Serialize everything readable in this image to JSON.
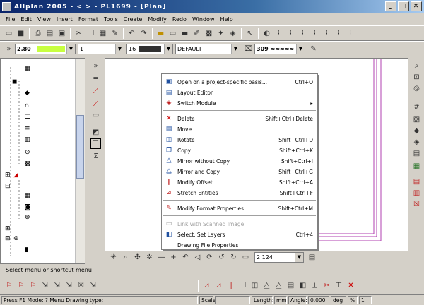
{
  "title": "Allplan 2005 - < > - PL1699 - [Plan]",
  "window": {
    "min": "_",
    "max": "□",
    "close": "✕"
  },
  "menu": [
    "File",
    "Edit",
    "View",
    "Insert",
    "Format",
    "Tools",
    "Create",
    "Modify",
    "Redo",
    "Window",
    "Help"
  ],
  "format_bar": {
    "pen_value": "2.80",
    "line_value": "1",
    "color_value": "16",
    "layer_value": "DEFAULT",
    "style_value": "309 ≈≈≈≈≈"
  },
  "context_menu": {
    "items": [
      {
        "label": "Open on a project-specific basis...",
        "shortcut": "Ctrl+O",
        "icon": "open-icon",
        "disabled": false
      },
      {
        "label": "Layout Editor",
        "shortcut": "",
        "icon": "layout-icon",
        "disabled": false
      },
      {
        "label": "Switch Module",
        "shortcut": "",
        "icon": "module-icon",
        "disabled": false,
        "submenu": true
      },
      {
        "label": "Delete",
        "shortcut": "Shift+Ctrl+Delete",
        "icon": "delete-icon",
        "disabled": false
      },
      {
        "label": "Move",
        "shortcut": "",
        "icon": "move-icon",
        "disabled": false
      },
      {
        "label": "Rotate",
        "shortcut": "Shift+Ctrl+D",
        "icon": "rotate-icon",
        "disabled": false
      },
      {
        "label": "Copy",
        "shortcut": "Shift+Ctrl+K",
        "icon": "copy-icon",
        "disabled": false
      },
      {
        "label": "Mirror without Copy",
        "shortcut": "Shift+Ctrl+I",
        "icon": "mirror-icon",
        "disabled": false
      },
      {
        "label": "Mirror and Copy",
        "shortcut": "Shift+Ctrl+G",
        "icon": "mirror-copy-icon",
        "disabled": false
      },
      {
        "label": "Modify Offset",
        "shortcut": "Shift+Ctrl+A",
        "icon": "offset-icon",
        "disabled": false
      },
      {
        "label": "Stretch Entities",
        "shortcut": "Shift+Ctrl+F",
        "icon": "stretch-icon",
        "disabled": false
      },
      {
        "label": "Modify Format Properties",
        "shortcut": "Shift+Ctrl+M",
        "icon": "format-icon",
        "disabled": false
      },
      {
        "label": "Link with Scanned Image",
        "shortcut": "",
        "icon": "scan-icon",
        "disabled": true
      },
      {
        "label": "Select, Set Layers",
        "shortcut": "Ctrl+4",
        "icon": "layers-icon",
        "disabled": false
      },
      {
        "label": "Drawing File Properties",
        "shortcut": "",
        "icon": "",
        "disabled": false
      }
    ]
  },
  "bottom_toolbar": {
    "zoom_value": "2.124"
  },
  "command_line": "Select menu or shortcut menu",
  "status": {
    "left": "Press F1 Mode: ? Menu   Drawing type:",
    "scale_label": "Scale:",
    "length_label": "Length:",
    "length_unit": "mm",
    "angle_label": "Angle:",
    "angle_value": "0.000",
    "angle_unit": "deg",
    "percent_label": "%",
    "percent_value": "1"
  },
  "colors": {
    "title_start": "#0a246a",
    "title_end": "#a6caf0",
    "pen_swatch": "#c8ff40"
  }
}
